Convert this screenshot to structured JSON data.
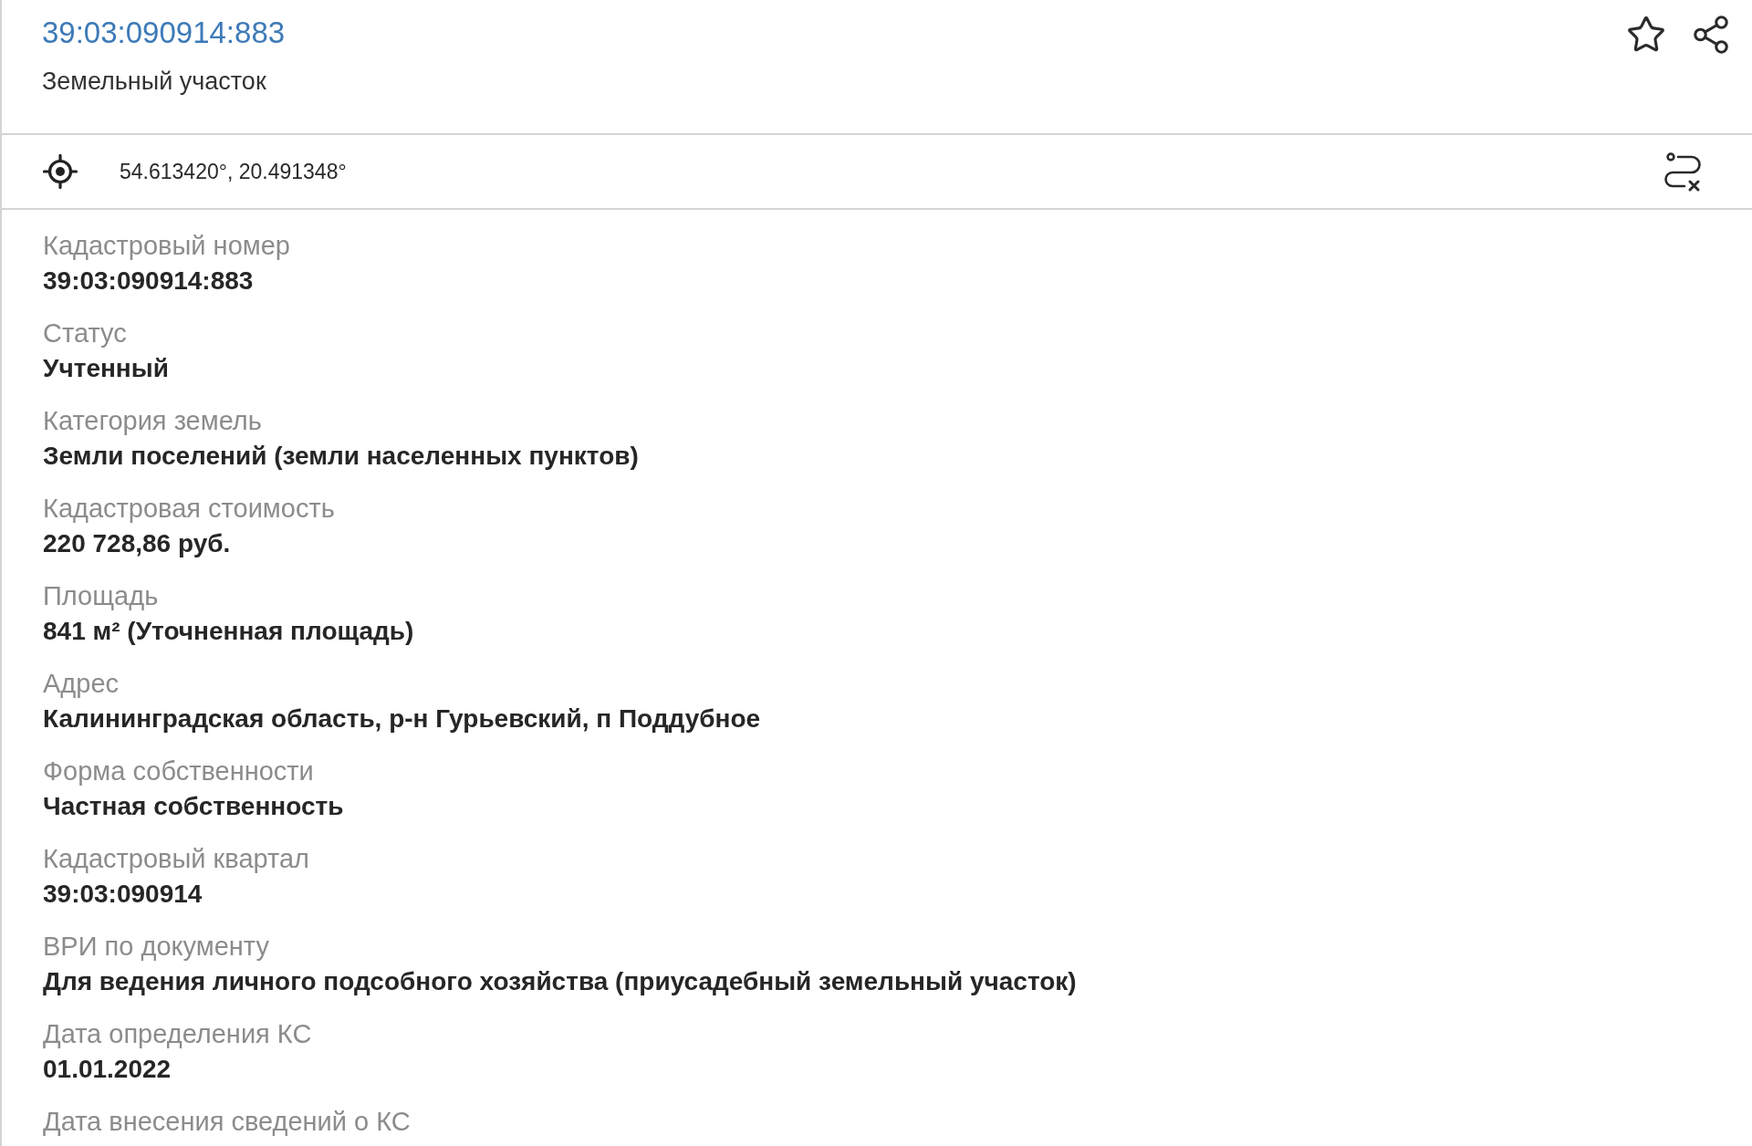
{
  "header": {
    "cadastral_number": "39:03:090914:883",
    "object_type": "Земельный участок"
  },
  "location": {
    "coordinates": "54.613420°, 20.491348°"
  },
  "fields": [
    {
      "label": "Кадастровый номер",
      "value": "39:03:090914:883"
    },
    {
      "label": "Статус",
      "value": "Учтенный"
    },
    {
      "label": "Категория земель",
      "value": "Земли поселений (земли населенных пунктов)"
    },
    {
      "label": "Кадастровая стоимость",
      "value": "220 728,86 руб."
    },
    {
      "label": "Площадь",
      "value": "841 м² (Уточненная площадь)"
    },
    {
      "label": "Адрес",
      "value": "Калининградская область, р-н Гурьевский, п Поддубное"
    },
    {
      "label": "Форма собственности",
      "value": "Частная собственность"
    },
    {
      "label": "Кадастровый квартал",
      "value": "39:03:090914"
    },
    {
      "label": "ВРИ по документу",
      "value": "Для ведения личного подсобного хозяйства (приусадебный земельный участок)"
    },
    {
      "label": "Дата определения КС",
      "value": "01.01.2022"
    },
    {
      "label": "Дата внесения сведений о КС"
    }
  ]
}
